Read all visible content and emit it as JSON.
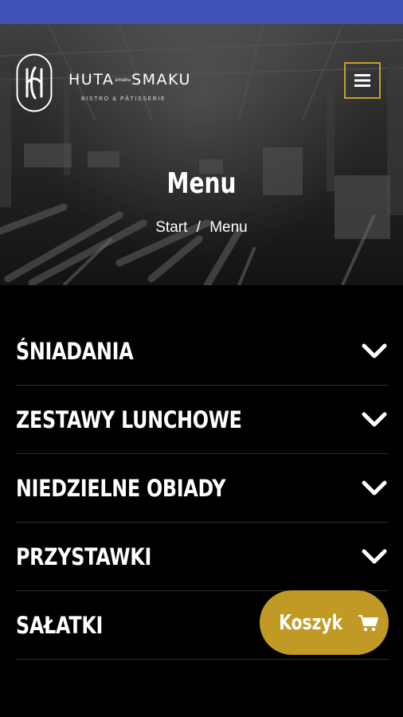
{
  "header": {
    "brand_name_left": "HUTA",
    "brand_name_small": "smaku",
    "brand_name_right": "SMAKU",
    "brand_tagline": "BISTRO & PÂTISSERIE",
    "logo_letter": "H"
  },
  "hero": {
    "title": "Menu",
    "breadcrumb": {
      "home": "Start",
      "separator": "/",
      "current": "Menu"
    }
  },
  "menu_sections": [
    {
      "label": "ŚNIADANIA"
    },
    {
      "label": "ZESTAWY LUNCHOWE"
    },
    {
      "label": "NIEDZIELNE OBIADY"
    },
    {
      "label": "PRZYSTAWKI"
    },
    {
      "label": "SAŁATKI"
    }
  ],
  "cart": {
    "label": "Koszyk",
    "icon": "cart-icon"
  },
  "colors": {
    "status_bar": "#3f51b5",
    "accent_gold": "#c09a24",
    "toggle_border": "#c8a02a",
    "background": "#000000"
  }
}
